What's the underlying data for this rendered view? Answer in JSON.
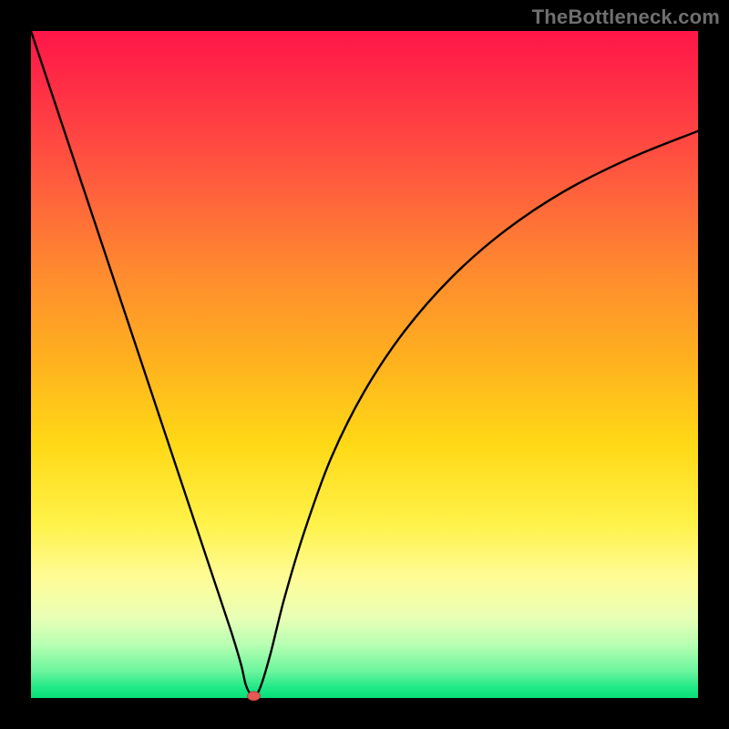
{
  "watermark": "TheBottleneck.com",
  "chart_data": {
    "type": "line",
    "title": "",
    "xlabel": "",
    "ylabel": "",
    "xlim": [
      0,
      100
    ],
    "ylim": [
      0,
      100
    ],
    "grid": false,
    "legend": false,
    "series": [
      {
        "name": "curve",
        "x": [
          0,
          3,
          6,
          9,
          12,
          15,
          18,
          21,
          24,
          27,
          30,
          31.5,
          32.2,
          33,
          33.8,
          34.6,
          36,
          38,
          41,
          45,
          50,
          56,
          63,
          71,
          80,
          90,
          100
        ],
        "y": [
          100,
          91,
          82,
          73,
          64,
          55,
          46,
          37,
          28,
          19,
          10,
          5,
          2,
          0.5,
          0.5,
          2.2,
          7,
          15,
          25,
          36,
          46,
          55,
          63,
          70,
          76,
          81,
          85
        ]
      }
    ],
    "marker": {
      "x": 33.4,
      "y": 0.3
    },
    "background_gradient": {
      "top": "#ff1648",
      "bottom": "#06de78"
    }
  }
}
